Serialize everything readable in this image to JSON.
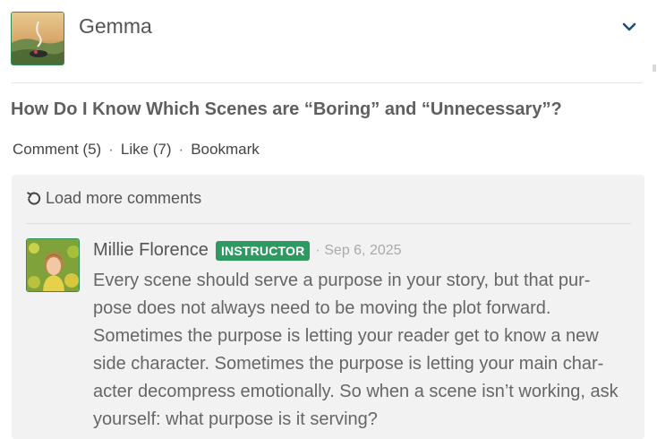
{
  "post": {
    "author": "Gemma",
    "title": "How Do I Know Which Scenes are “Boring” and “Unnecessary”?"
  },
  "actions": {
    "comment_label": "Comment (5)",
    "like_label": "Like (7)",
    "bookmark_label": "Bookmark",
    "separator": "·"
  },
  "comments": {
    "load_more_label": "Load more comments",
    "items": [
      {
        "author": "Millie Florence",
        "badge": "INSTRUCTOR",
        "date": "· Sep 6, 2025",
        "lines": [
          "Every scene should serve a purpose in your story, but that pur-",
          "pose does not always need to be moving the plot forward.",
          "Sometimes the purpose is letting your reader get to know a new",
          "side character. Sometimes the purpose is letting your main char-",
          "acter decompress emotionally. So when a scene isn’t working, ask",
          "yourself: what purpose is it serving?"
        ]
      }
    ]
  },
  "icons": {
    "expand": "chevron-down-icon",
    "reload": "reload-icon"
  },
  "colors": {
    "accent_green": "#2e9a62",
    "chevron_blue": "#1f4f7a",
    "panel_bg": "#f2f2f2"
  }
}
